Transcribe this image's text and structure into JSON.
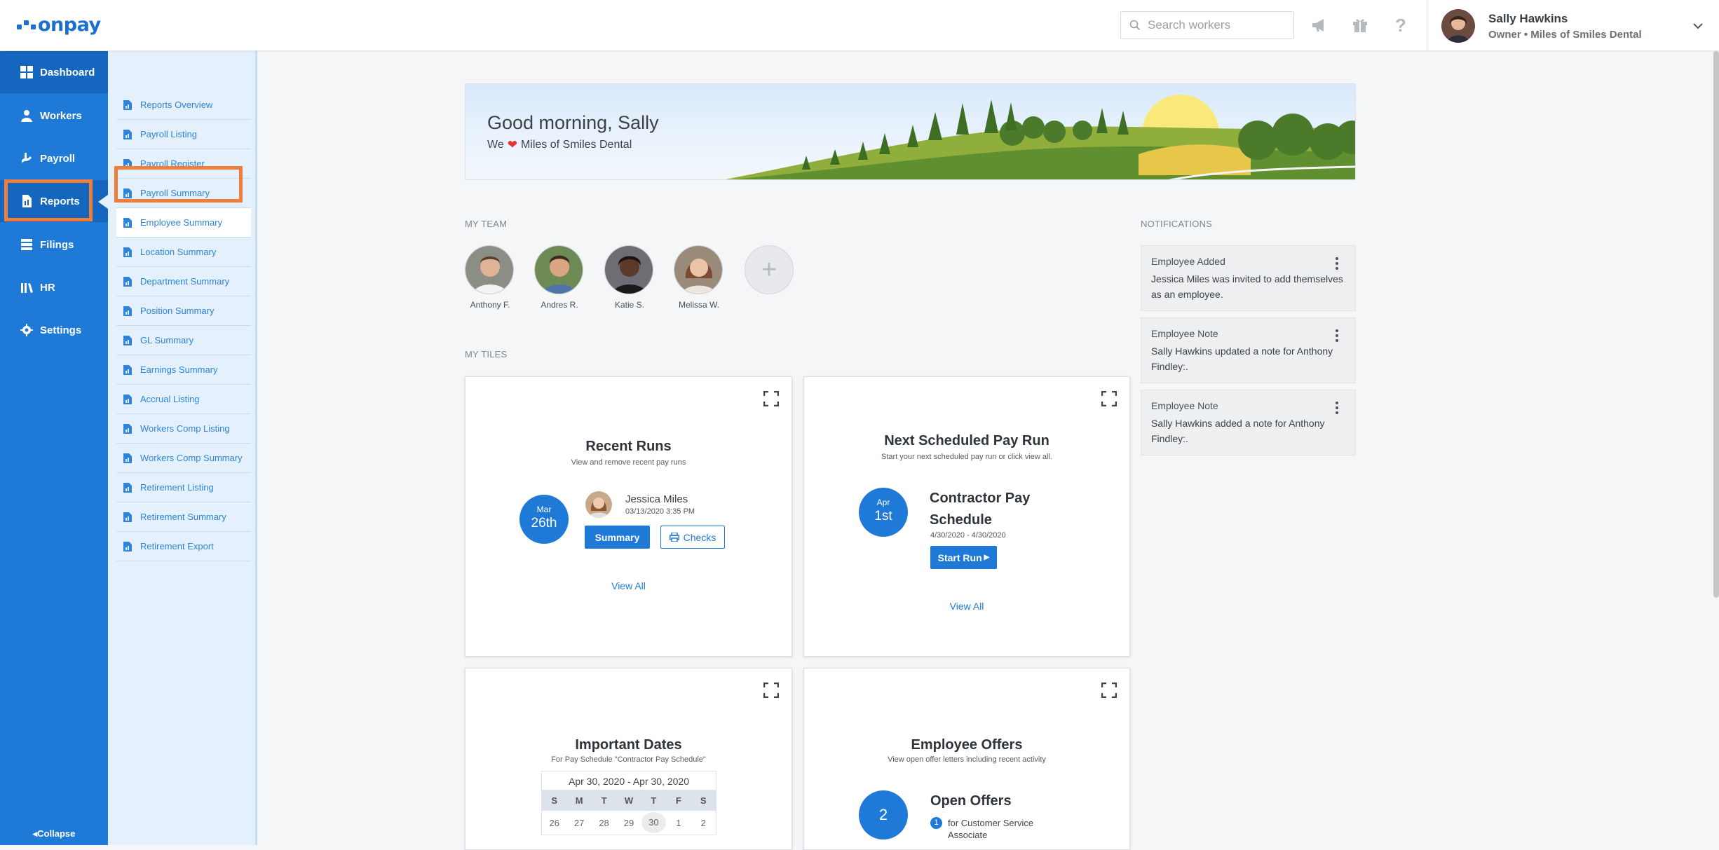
{
  "brand": {
    "logo_text": "onpay",
    "accent": "#1e7ad6",
    "highlight": "#ef7e3b"
  },
  "header": {
    "search_placeholder": "Search workers",
    "icons": [
      "megaphone-icon",
      "gift-icon",
      "help-icon"
    ],
    "user": {
      "name": "Sally Hawkins",
      "role": "Owner • Miles of Smiles Dental"
    }
  },
  "sidebar": {
    "items": [
      {
        "label": "Dashboard",
        "icon": "dashboard-icon"
      },
      {
        "label": "Workers",
        "icon": "workers-icon"
      },
      {
        "label": "Payroll",
        "icon": "payroll-icon"
      },
      {
        "label": "Reports",
        "icon": "reports-icon"
      },
      {
        "label": "Filings",
        "icon": "filings-icon"
      },
      {
        "label": "HR",
        "icon": "hr-icon"
      },
      {
        "label": "Settings",
        "icon": "gear-icon"
      }
    ],
    "collapse_label": "Collapse"
  },
  "reports_menu": {
    "items": [
      "Reports Overview",
      "Payroll Listing",
      "Payroll Register",
      "Payroll Summary",
      "Employee Summary",
      "Location Summary",
      "Department Summary",
      "Position Summary",
      "GL Summary",
      "Earnings Summary",
      "Accrual Listing",
      "Workers Comp Listing",
      "Workers Comp Summary",
      "Retirement Listing",
      "Retirement Summary",
      "Retirement Export"
    ]
  },
  "banner": {
    "greeting": "Good morning, Sally",
    "we": "We",
    "company": "Miles of Smiles Dental"
  },
  "team": {
    "label": "MY TEAM",
    "members": [
      "Anthony F.",
      "Andres R.",
      "Katie S.",
      "Melissa W."
    ]
  },
  "tiles_label": "MY TILES",
  "tiles": {
    "recent_runs": {
      "title": "Recent Runs",
      "subtitle": "View and remove recent pay runs",
      "month": "Mar",
      "day": "26th",
      "person": "Jessica Miles",
      "timestamp": "03/13/2020 3:35 PM",
      "summary_btn": "Summary",
      "checks_btn": "Checks",
      "view_all": "View All"
    },
    "next_run": {
      "title": "Next Scheduled Pay Run",
      "subtitle": "Start your next scheduled pay run or click view all.",
      "month": "Apr",
      "day": "1st",
      "schedule_line1": "Contractor Pay",
      "schedule_line2": "Schedule",
      "range": "4/30/2020 - 4/30/2020",
      "start_btn": "Start Run",
      "view_all": "View All"
    },
    "important_dates": {
      "title": "Important Dates",
      "subtitle": "For Pay Schedule \"Contractor Pay Schedule\"",
      "calendar_range": "Apr 30, 2020 - Apr 30, 2020",
      "weekdays": [
        "S",
        "M",
        "T",
        "W",
        "T",
        "F",
        "S"
      ],
      "days": [
        "26",
        "27",
        "28",
        "29",
        "30",
        "1",
        "2"
      ]
    },
    "employee_offers": {
      "title": "Employee Offers",
      "subtitle": "View open offer letters including recent activity",
      "count": "2",
      "heading": "Open Offers",
      "item_count": "1",
      "item_text": "for Customer Service Associate"
    }
  },
  "notifications": {
    "label": "NOTIFICATIONS",
    "items": [
      {
        "type": "Employee Added",
        "text": "Jessica Miles was invited to add themselves as an employee."
      },
      {
        "type": "Employee Note",
        "text": "Sally Hawkins updated a note for Anthony Findley:."
      },
      {
        "type": "Employee Note",
        "text": "Sally Hawkins added a note for Anthony Findley:."
      }
    ]
  }
}
